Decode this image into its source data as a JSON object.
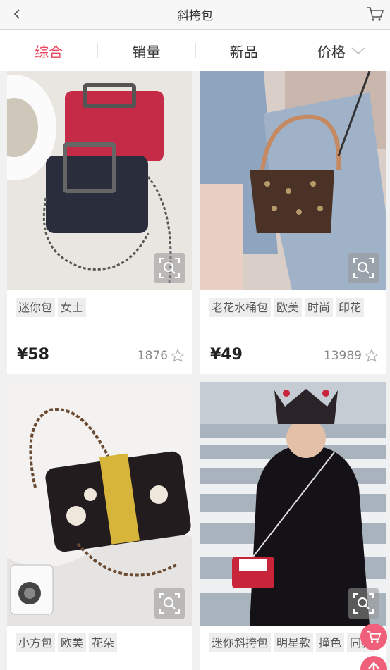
{
  "header": {
    "title": "斜挎包",
    "back_icon": "chevron-left-icon",
    "cart_icon": "cart-icon"
  },
  "sort_tabs": [
    {
      "label": "综合",
      "active": true
    },
    {
      "label": "销量",
      "active": false
    },
    {
      "label": "新品",
      "active": false
    },
    {
      "label": "价格",
      "active": false,
      "icon": "chevron-down-icon"
    }
  ],
  "accent_color": "#e8485e",
  "products": [
    {
      "tags": [
        "迷你包",
        "女士"
      ],
      "price": "¥58",
      "likes": "1876"
    },
    {
      "tags": [
        "老花水桶包",
        "欧美",
        "时尚",
        "印花"
      ],
      "price": "¥49",
      "likes": "13989"
    },
    {
      "tags": [
        "小方包",
        "欧美",
        "花朵"
      ],
      "price": "",
      "likes": ""
    },
    {
      "tags": [
        "迷你斜挎包",
        "明星款",
        "撞色",
        "同款"
      ],
      "price": "",
      "likes": ""
    }
  ],
  "floating": {
    "cart_icon": "cart-icon",
    "top_icon": "arrow-up-icon"
  }
}
